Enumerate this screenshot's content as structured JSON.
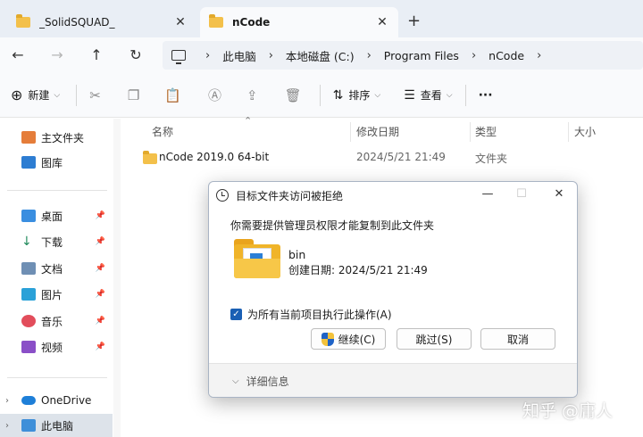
{
  "tabs": [
    {
      "label": "_SolidSQUAD_",
      "close": "✕"
    },
    {
      "label": "nCode",
      "close": "✕"
    }
  ],
  "new_tab": "+",
  "breadcrumbs": [
    "此电脑",
    "本地磁盘 (C:)",
    "Program Files",
    "nCode"
  ],
  "toolbar": {
    "new": "新建",
    "sort": "排序",
    "view": "查看",
    "more": "···"
  },
  "sidebar": {
    "items": [
      {
        "label": "主文件夹"
      },
      {
        "label": "图库"
      },
      {
        "label": "桌面"
      },
      {
        "label": "下载"
      },
      {
        "label": "文档"
      },
      {
        "label": "图片"
      },
      {
        "label": "音乐"
      },
      {
        "label": "视频"
      },
      {
        "label": "OneDrive"
      },
      {
        "label": "此电脑"
      }
    ]
  },
  "columns": [
    "名称",
    "修改日期",
    "类型",
    "大小"
  ],
  "rows": [
    {
      "name": "nCode 2019.0 64-bit",
      "modified": "2024/5/21 21:49",
      "type": "文件夹"
    }
  ],
  "dialog": {
    "title": "目标文件夹访问被拒绝",
    "message": "你需要提供管理员权限才能复制到此文件夹",
    "folder_name": "bin",
    "created": "创建日期: 2024/5/21 21:49",
    "checkbox_label": "为所有当前项目执行此操作(A)",
    "continue": "继续(C)",
    "skip": "跳过(S)",
    "cancel": "取消",
    "details": "详细信息"
  },
  "watermark": "知乎 @庸人",
  "colors": {
    "accent": "#1a5fb4",
    "folder": "#f0b429"
  }
}
